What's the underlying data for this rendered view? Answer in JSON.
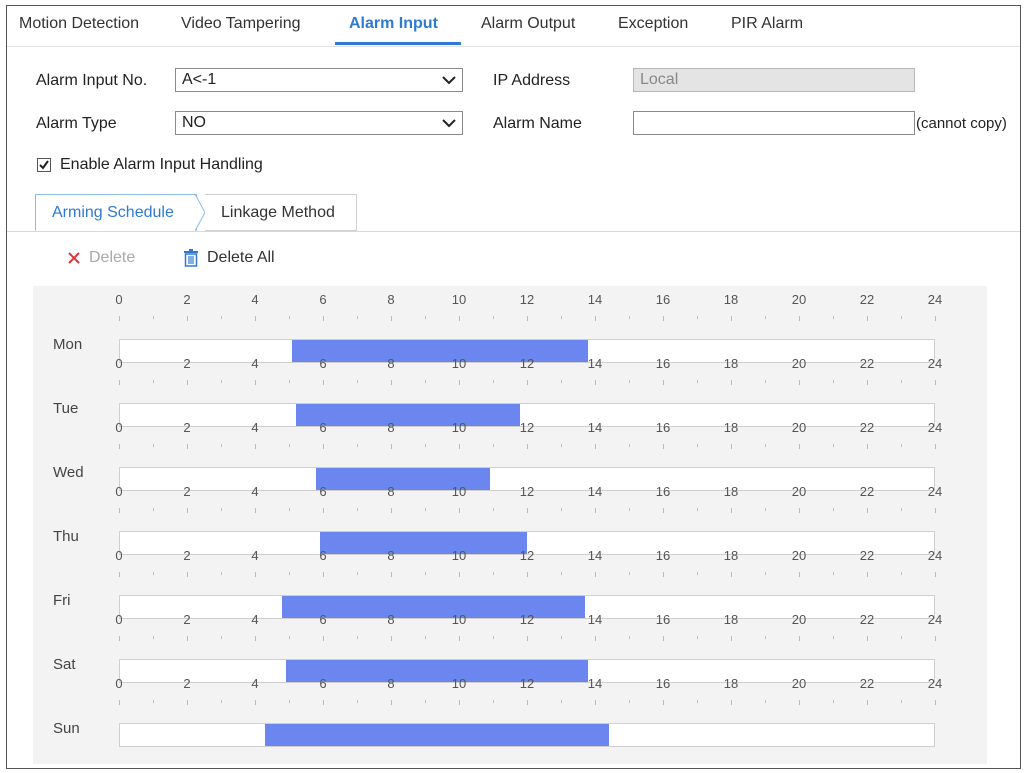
{
  "tabs": [
    {
      "label": "Motion Detection"
    },
    {
      "label": "Video Tampering"
    },
    {
      "label": "Alarm Input",
      "active": true
    },
    {
      "label": "Alarm Output"
    },
    {
      "label": "Exception"
    },
    {
      "label": "PIR Alarm"
    }
  ],
  "form": {
    "alarm_input_no_label": "Alarm Input No.",
    "alarm_input_no_value": "A<-1",
    "ip_address_label": "IP Address",
    "ip_address_value": "Local",
    "alarm_type_label": "Alarm Type",
    "alarm_type_value": "NO",
    "alarm_name_label": "Alarm Name",
    "alarm_name_value": "",
    "alarm_name_note": "(cannot copy)",
    "enable_label": "Enable Alarm Input Handling",
    "enable_checked": true
  },
  "subtabs": [
    {
      "label": "Arming Schedule",
      "active": true
    },
    {
      "label": "Linkage Method"
    }
  ],
  "toolbar": {
    "delete_label": "Delete",
    "delete_all_label": "Delete All"
  },
  "schedule": {
    "tick_labels": [
      "0",
      "2",
      "4",
      "6",
      "8",
      "10",
      "12",
      "14",
      "16",
      "18",
      "20",
      "22",
      "24"
    ],
    "accent": "#6b86ef",
    "days": [
      {
        "day": "Mon",
        "segments": [
          [
            5.1,
            13.8
          ]
        ]
      },
      {
        "day": "Tue",
        "segments": [
          [
            5.2,
            11.8
          ]
        ]
      },
      {
        "day": "Wed",
        "segments": [
          [
            5.8,
            10.9
          ]
        ]
      },
      {
        "day": "Thu",
        "segments": [
          [
            5.9,
            12.0
          ]
        ]
      },
      {
        "day": "Fri",
        "segments": [
          [
            4.8,
            13.7
          ]
        ]
      },
      {
        "day": "Sat",
        "segments": [
          [
            4.9,
            13.8
          ]
        ]
      },
      {
        "day": "Sun",
        "segments": [
          [
            4.3,
            14.4
          ]
        ]
      }
    ]
  }
}
